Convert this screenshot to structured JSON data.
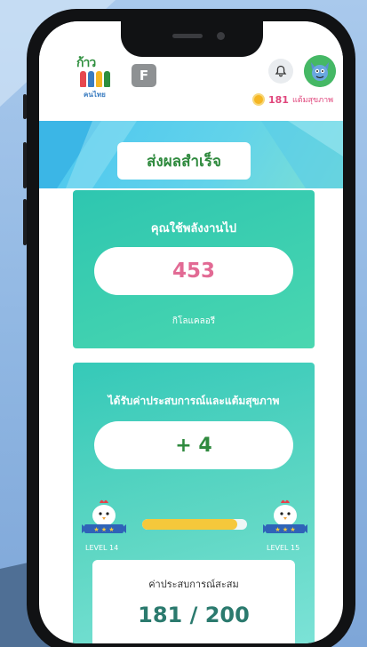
{
  "header": {
    "logo": {
      "title": "ก้าว",
      "subtitle": "คนไทย"
    },
    "f_button_label": "F",
    "bell_icon": "bell-icon",
    "avatar_icon": "avatar-icon",
    "points": {
      "value": "181",
      "label": "แต้มสุขภาพ",
      "icon": "coin-icon"
    }
  },
  "banner": {
    "title": "ส่งผลสำเร็จ"
  },
  "energy_card": {
    "title": "คุณใช้พลังงานไป",
    "value": "453",
    "unit": "กิโลแคลอรี"
  },
  "reward_card": {
    "title": "ได้รับค่าประสบการณ์และแต้มสุขภาพ",
    "gain": "+ 4",
    "current_level": "LEVEL 14",
    "next_level": "LEVEL 15",
    "progress_fraction": 0.905
  },
  "experience": {
    "title": "ค่าประสบการณ์สะสม",
    "current": "181",
    "separator": "/",
    "total": "200"
  },
  "colors": {
    "accent_green": "#2f8a3e",
    "card_teal": "#35c9b8",
    "calorie_pink": "#e26a94",
    "points_pink": "#e0467c",
    "progress_yellow": "#f5c83b"
  }
}
